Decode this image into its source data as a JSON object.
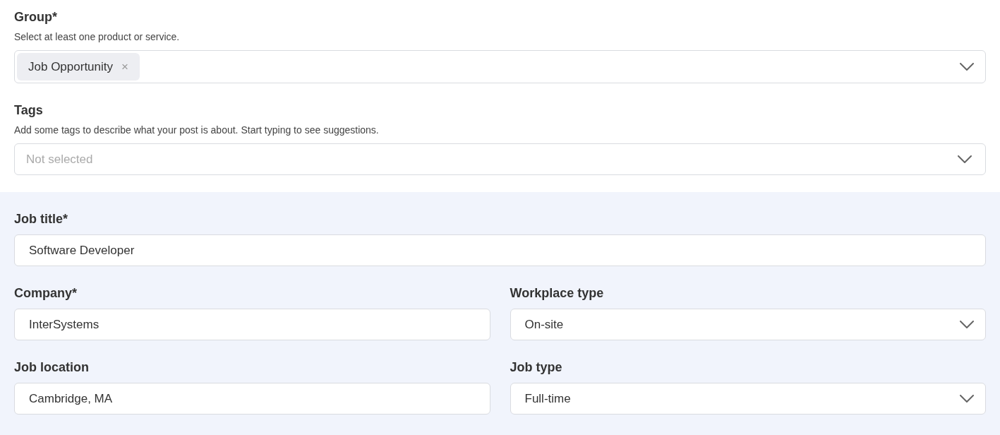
{
  "group": {
    "label": "Group*",
    "hint": "Select at least one product or service.",
    "chips": [
      {
        "label": "Job Opportunity",
        "remove": "×"
      }
    ]
  },
  "tags": {
    "label": "Tags",
    "hint": "Add some tags to describe what your post is about. Start typing to see suggestions.",
    "placeholder": "Not selected"
  },
  "job_rows": [
    {
      "fields": [
        {
          "kind": "text",
          "label": "Job title*",
          "value": "Software Developer"
        }
      ]
    },
    {
      "fields": [
        {
          "kind": "text",
          "label": "Company*",
          "value": "InterSystems"
        },
        {
          "kind": "select",
          "label": "Workplace type",
          "value": "On-site"
        }
      ]
    },
    {
      "fields": [
        {
          "kind": "text",
          "label": "Job location",
          "value": "Cambridge, MA"
        },
        {
          "kind": "select",
          "label": "Job type",
          "value": "Full-time"
        }
      ]
    }
  ]
}
